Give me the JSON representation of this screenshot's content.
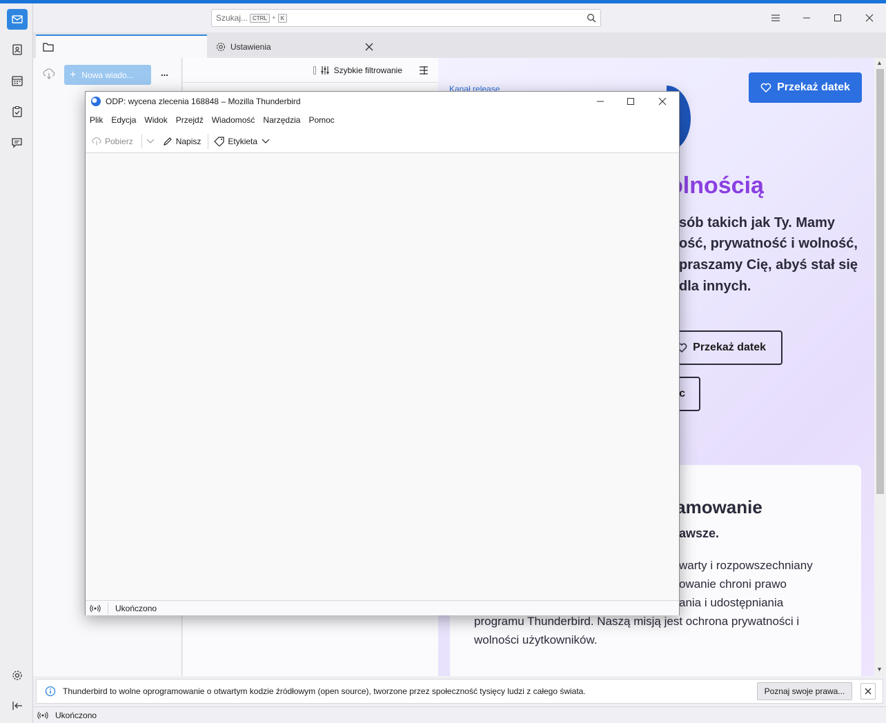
{
  "search": {
    "placeholder": "Szukaj...",
    "kbd_ctrl": "CTRL",
    "plus": "+",
    "kbd_key": "K"
  },
  "tabs": [
    {
      "label": ""
    },
    {
      "label": "Ustawienia"
    }
  ],
  "folder_pane": {
    "new_message": "Nowa wiado...",
    "more": "..."
  },
  "thread_pane": {
    "quick_filter": "Szybkie filtrowanie"
  },
  "promo": {
    "channel": "Kanał release",
    "donate_top": "Przekaż datek",
    "heading_fragment": "olnością",
    "para_lines": [
      "sób takich jak Ty. Mamy",
      "ość, prywatność i wolność,",
      "praszamy Cię, abyś stał się",
      "dla innych."
    ],
    "donate_mid": "Przekaż datek",
    "help_fragment": "c",
    "card_heading": "ramowanie",
    "card_sub": "awsze.",
    "card_lines": [
      "warty i rozpowszechniany",
      "owanie chroni prawo",
      "ania i udostępniania",
      "programu Thunderbird. Naszą misją jest ochrona prywatności i",
      "wolności użytkowników."
    ]
  },
  "notification": {
    "text": "Thunderbird to wolne oprogramowanie o otwartym kodzie źródłowym (open source), tworzone przez społeczność tysięcy ludzi z całego świata.",
    "button": "Poznaj swoje prawa..."
  },
  "status": {
    "text": "Ukończono"
  },
  "popup": {
    "title": "ODP: wycena zlecenia 168848 – Mozilla Thunderbird",
    "menu": [
      "Plik",
      "Edycja",
      "Widok",
      "Przejdź",
      "Wiadomość",
      "Narzędzia",
      "Pomoc"
    ],
    "toolbar": {
      "get": "Pobierz",
      "write": "Napisz",
      "tag": "Etykieta"
    },
    "status": "Ukończono"
  },
  "colors": {
    "accent": "#2f86e0",
    "donate": "#2b6fe0",
    "heading_purple": "#8a3fe0"
  }
}
